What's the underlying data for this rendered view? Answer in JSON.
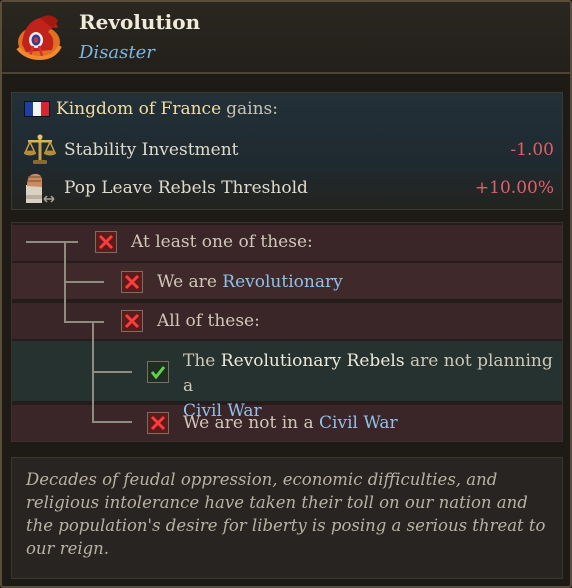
{
  "header": {
    "title": "Revolution",
    "subtitle": "Disaster",
    "icon": "liberty-cap-icon"
  },
  "gains": {
    "country": "Kingdom of France",
    "suffix": "gains:",
    "flag_colors": [
      "#1f3fa0",
      "#f4f4f4",
      "#d7262e"
    ],
    "rows": [
      {
        "icon": "scales-icon",
        "label": "Stability Investment",
        "value": "-1.00"
      },
      {
        "icon": "raised-fist-icon",
        "label": "Pop Leave Rebels Threshold",
        "value": "+10.00%"
      }
    ]
  },
  "conditions": {
    "c1": {
      "text": "At least one of these:",
      "met": false
    },
    "c2": {
      "prefix": "We are ",
      "link": "Revolutionary",
      "met": false
    },
    "c3": {
      "text": "All of these:",
      "met": false
    },
    "c4": {
      "the": "The",
      "subject": "Revolutionary Rebels",
      "middle": "are not planning a",
      "link": "Civil War",
      "met": true
    },
    "c5": {
      "prefix": "We are not in a ",
      "link": "Civil War",
      "met": false
    }
  },
  "description": "Decades of feudal oppression, economic difficulties, and religious intolerance have taken their toll on our nation and the population's desire for liberty is posing a serious threat to our reign.",
  "colors": {
    "positive": "#e0606a",
    "link": "#8fc2ea",
    "title": "#f0ead8",
    "subtitle": "#7fb6df"
  }
}
